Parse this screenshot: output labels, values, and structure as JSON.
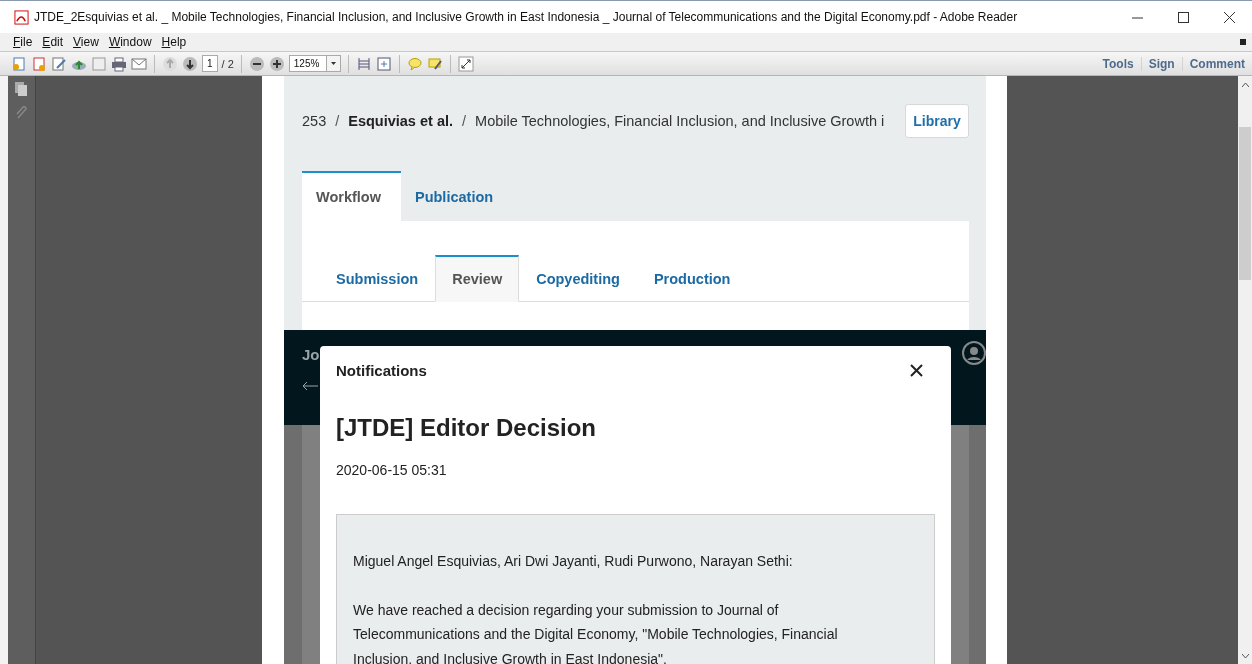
{
  "window": {
    "title": "JTDE_2Esquivias et al. _ Mobile Technologies, Financial Inclusion, and Inclusive Growth in East Indonesia _ Journal of Telecommunications and the Digital Economy.pdf - Adobe Reader"
  },
  "menu": [
    "File",
    "Edit",
    "View",
    "Window",
    "Help"
  ],
  "toolbar": {
    "page": "1",
    "page_count": "/ 2",
    "zoom": "125%"
  },
  "task_buttons": [
    "Tools",
    "Sign",
    "Comment"
  ],
  "document": {
    "breadcrumb": {
      "number": "253",
      "separator_1": "/",
      "authors": "Esquivias et al.",
      "separator_2": "/",
      "title": "Mobile Technologies, Financial Inclusion, and Inclusive Growth i"
    },
    "library_button": "Library",
    "tabs": [
      {
        "label": "Workflow",
        "selected": true
      },
      {
        "label": "Publication",
        "selected": false
      }
    ],
    "stage_tabs": [
      {
        "label": "Submission",
        "selected": false
      },
      {
        "label": "Review",
        "selected": true
      },
      {
        "label": "Copyediting",
        "selected": false
      },
      {
        "label": "Production",
        "selected": false
      }
    ],
    "header_text": "Jo",
    "modal": {
      "heading": "Notifications",
      "title": "[JTDE] Editor Decision",
      "date": "2020-06-15 05:31",
      "message": [
        "Miguel Angel Esquivias, Ari Dwi Jayanti, Rudi Purwono, Narayan Sethi:",
        "We have reached a decision regarding your submission to Journal of Telecommunications and the Digital Economy, \"Mobile Technologies, Financial Inclusion, and Inclusive Growth in East Indonesia\"."
      ]
    }
  }
}
